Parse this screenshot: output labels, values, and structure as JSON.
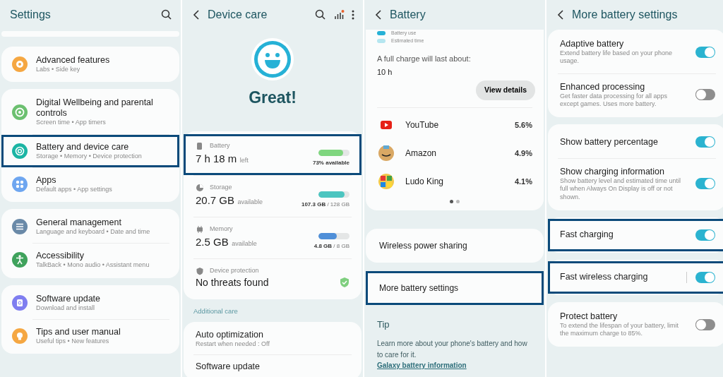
{
  "settings_screen": {
    "title": "Settings",
    "groups": [
      [
        {
          "title": "Advanced features",
          "subtitle": "Labs  •  Side key",
          "kind": "gear",
          "color": "#f5a742",
          "highlighted": false
        }
      ],
      [
        {
          "title": "Digital Wellbeing and parental controls",
          "subtitle": "Screen time  •  App timers",
          "kind": "ring",
          "color": "#6cc070",
          "highlighted": false
        },
        {
          "title": "Battery and device care",
          "subtitle": "Storage  •  Memory  •  Device protection",
          "kind": "care",
          "color": "#1bb5a4",
          "highlighted": true
        },
        {
          "title": "Apps",
          "subtitle": "Default apps  •  App settings",
          "kind": "grid",
          "color": "#6ea6f0",
          "highlighted": false
        }
      ],
      [
        {
          "title": "General management",
          "subtitle": "Language and keyboard  •  Date and time",
          "kind": "sliders",
          "color": "#6a8aa8",
          "highlighted": false
        },
        {
          "title": "Accessibility",
          "subtitle": "TalkBack  •  Mono audio  •  Assistant menu",
          "kind": "person",
          "color": "#3fa25c",
          "highlighted": false
        }
      ],
      [
        {
          "title": "Software update",
          "subtitle": "Download and install",
          "kind": "update",
          "color": "#7f7ef0",
          "highlighted": false
        },
        {
          "title": "Tips and user manual",
          "subtitle": "Useful tips  •  New features",
          "kind": "bulb",
          "color": "#f5a742",
          "highlighted": false
        }
      ]
    ]
  },
  "device_care_screen": {
    "title": "Device care",
    "status": "Great!",
    "meters": [
      {
        "label": "Battery",
        "kind": "battery",
        "value": "7 h 18 m",
        "unit": "left",
        "level": 0.8,
        "reading": "**73% available**",
        "color": "#7fd67f",
        "highlighted": true
      },
      {
        "label": "Storage",
        "kind": "pie",
        "value": "20.7 GB",
        "unit": "available",
        "level": 0.85,
        "reading": "**107.3 GB** / 128 GB",
        "color": "#4cc5c0",
        "highlighted": false
      },
      {
        "label": "Memory",
        "kind": "chip",
        "value": "2.5 GB",
        "unit": "available",
        "level": 0.6,
        "reading": "**4.8 GB** / 8 GB",
        "color": "#4f8fd8",
        "highlighted": false
      }
    ],
    "protection": {
      "label": "Device protection",
      "value": "No threats found"
    },
    "section": "Additional care",
    "items": [
      {
        "title": "Auto optimization",
        "subtitle": "Restart when needed : Off"
      },
      {
        "title": "Software update"
      }
    ]
  },
  "battery_screen": {
    "title": "Battery",
    "legend": [
      "Battery use",
      "Estimated time"
    ],
    "full_charge_label": "A full charge will last about:",
    "full_charge_value": "10 h",
    "button": "View details",
    "apps": [
      {
        "name": "YouTube",
        "usage": "5.6%",
        "kind": "youtube"
      },
      {
        "name": "Amazon",
        "usage": "4.9%",
        "kind": "amazon"
      },
      {
        "name": "Ludo King",
        "usage": "4.1%",
        "kind": "ludo"
      }
    ],
    "pages": [
      {
        "selected": true
      },
      {
        "selected": false
      }
    ],
    "items": [
      {
        "title": "Wireless power sharing",
        "highlighted": false
      },
      {
        "title": "More battery settings",
        "highlighted": true
      }
    ],
    "tip": {
      "title": "Tip",
      "text": "Learn more about your phone's battery and how to care for it.",
      "link": "Galaxy battery information"
    }
  },
  "more_battery_screen": {
    "title": "More battery settings",
    "groups": [
      [
        {
          "title": "Adaptive battery",
          "subtitle": "Extend battery life based on your phone usage.",
          "on": true,
          "highlighted": false
        },
        {
          "title": "Enhanced processing",
          "subtitle": "Get faster data processing for all apps except games. Uses more battery.",
          "on": false,
          "highlighted": false
        }
      ],
      [
        {
          "title": "Show battery percentage",
          "on": true,
          "highlighted": false
        },
        {
          "title": "Show charging information",
          "subtitle": "Show battery level and estimated time until full when Always On Display is off or not shown.",
          "on": true,
          "highlighted": false
        }
      ],
      [
        {
          "title": "Fast charging",
          "on": true,
          "highlighted": true
        }
      ],
      [
        {
          "title": "Fast wireless charging",
          "on": true,
          "highlighted": true,
          "divider": true
        }
      ],
      [
        {
          "title": "Protect battery",
          "subtitle": "To extend the lifespan of your battery, limit the maximum charge to 85%.",
          "on": false,
          "highlighted": false
        }
      ]
    ]
  }
}
